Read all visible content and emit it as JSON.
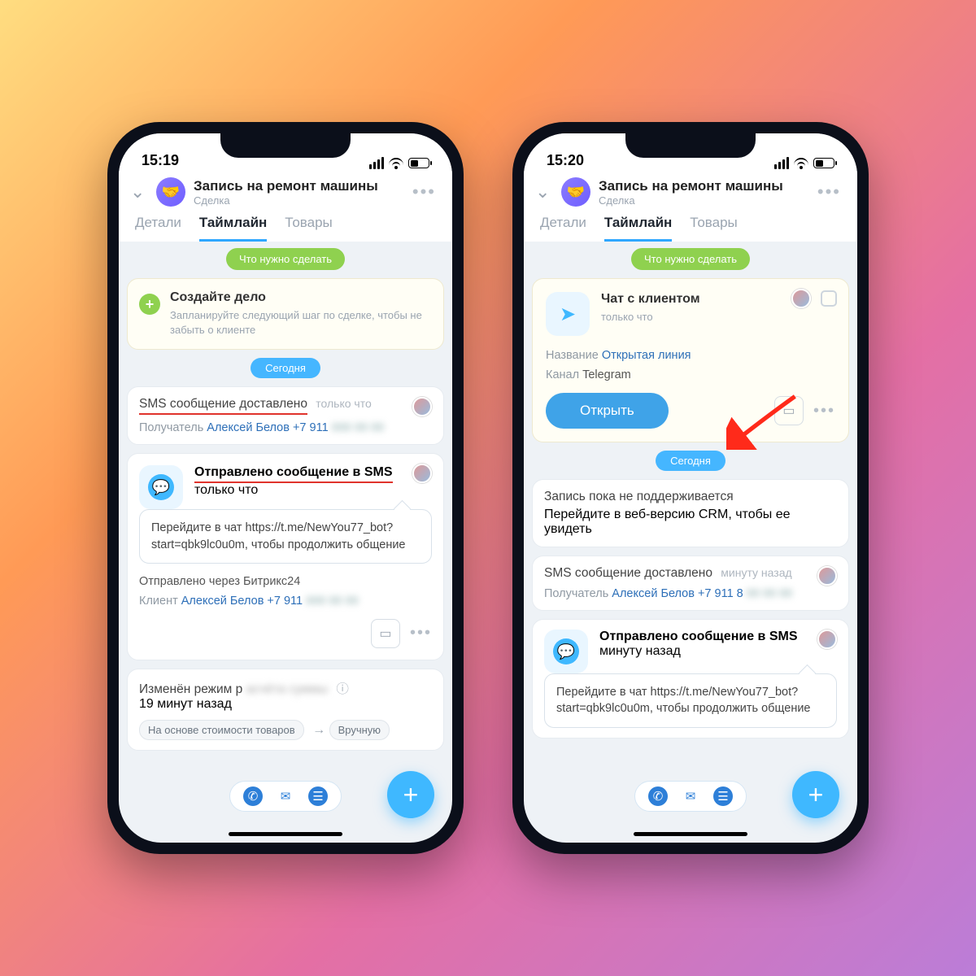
{
  "left": {
    "time": "15:19",
    "title": "Запись на ремонт машины",
    "subtitle": "Сделка",
    "tabs": [
      "Детали",
      "Таймлайн",
      "Товары"
    ],
    "todo_pill": "Что нужно сделать",
    "create": {
      "title": "Создайте дело",
      "sub": "Запланируйте следующий шаг по сделке, чтобы не забыть о клиенте"
    },
    "today": "Сегодня",
    "sms_delivered": {
      "title": "SMS сообщение доставлено",
      "meta": "только что",
      "recipient_label": "Получатель",
      "recipient": "Алексей Белов +7 911"
    },
    "sms_sent": {
      "title": "Отправлено сообщение в SMS",
      "meta": "только что",
      "body": "Перейдите в чат https://t.me/NewYou77_bot?start=qbk9lc0u0m, чтобы продолжить общение",
      "via": "Отправлено через Битрикс24",
      "client_label": "Клиент",
      "client": "Алексей Белов +7 911"
    },
    "mode_changed": {
      "title": "Изменён режим р",
      "ago": "19 минут назад",
      "chip1": "На основе стоимости товаров",
      "chip2": "Вручную"
    }
  },
  "right": {
    "time": "15:20",
    "title": "Запись на ремонт машины",
    "subtitle": "Сделка",
    "tabs": [
      "Детали",
      "Таймлайн",
      "Товары"
    ],
    "todo_pill": "Что нужно сделать",
    "chat": {
      "title": "Чат с клиентом",
      "meta": "только что",
      "name_label": "Название",
      "name": "Открытая линия",
      "channel_label": "Канал",
      "channel": "Telegram",
      "open": "Открыть"
    },
    "today": "Сегодня",
    "unsupported": {
      "title": "Запись пока не поддерживается",
      "sub": "Перейдите в веб-версию CRM, чтобы ее увидеть"
    },
    "sms_delivered": {
      "title": "SMS сообщение доставлено",
      "meta": "минуту назад",
      "recipient_label": "Получатель",
      "recipient": "Алексей Белов +7 911 8"
    },
    "sms_sent": {
      "title": "Отправлено сообщение в SMS",
      "meta": "минуту назад",
      "body": "Перейдите в чат https://t.me/NewYou77_bot?start=qbk9lc0u0m, чтобы продолжить общение"
    }
  }
}
